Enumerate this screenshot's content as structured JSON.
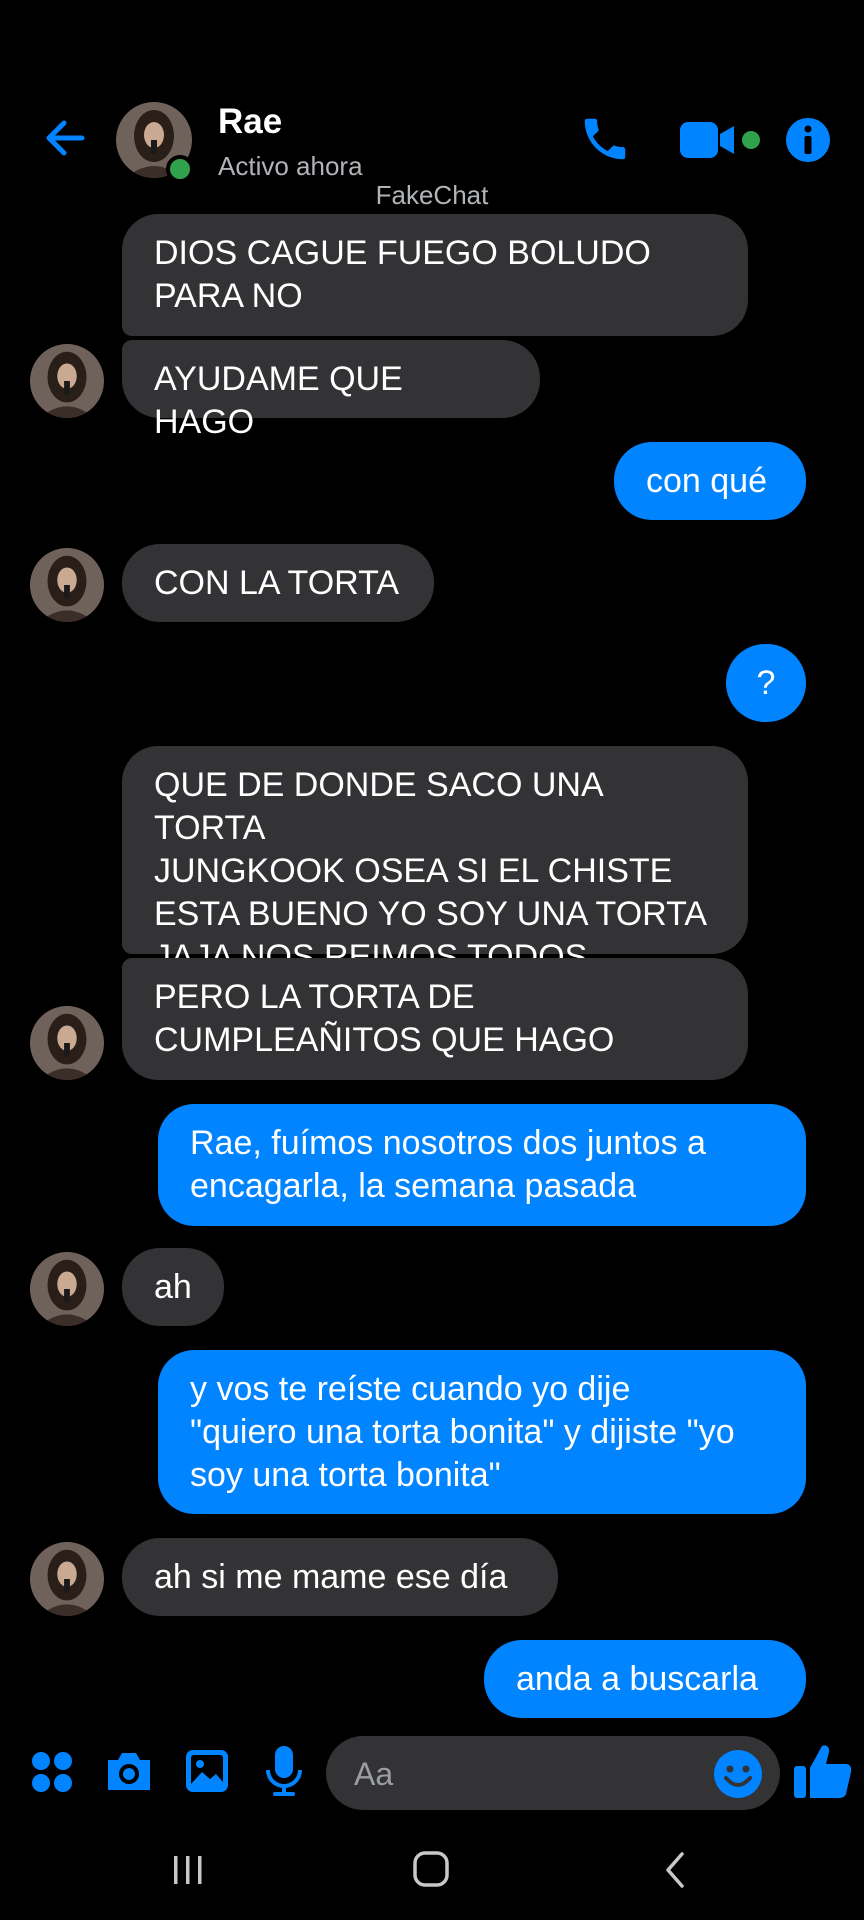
{
  "header": {
    "name": "Rae",
    "status": "Activo ahora",
    "watermark": "FakeChat"
  },
  "colors": {
    "accent": "#0084ff",
    "incoming_bubble": "#333336",
    "online": "#31a24c",
    "background": "#000000"
  },
  "messages": [
    {
      "from": "them",
      "lines": [
        "DIOS CAGUE FUEGO BOLUDO",
        "PARA NO"
      ]
    },
    {
      "from": "them",
      "lines": [
        "AYUDAME QUE HAGO"
      ]
    },
    {
      "from": "me",
      "lines": [
        "con qué"
      ]
    },
    {
      "from": "them",
      "lines": [
        "CON LA TORTA"
      ]
    },
    {
      "from": "me",
      "lines": [
        "?"
      ]
    },
    {
      "from": "them",
      "lines": [
        "QUE DE DONDE SACO UNA TORTA",
        "JUNGKOOK OSEA SI EL CHISTE",
        "ESTA BUENO YO SOY UNA TORTA",
        "JAJA NOS REIMOS TODOS"
      ]
    },
    {
      "from": "them",
      "lines": [
        "PERO LA TORTA DE",
        "CUMPLEAÑITOS QUE HAGO"
      ]
    },
    {
      "from": "me",
      "lines": [
        "Rae, fuímos nosotros dos juntos a",
        "encagarla, la semana pasada"
      ]
    },
    {
      "from": "them",
      "lines": [
        "ah"
      ]
    },
    {
      "from": "me",
      "lines": [
        "y vos te reíste cuando yo dije",
        "\"quiero una torta bonita\" y dijiste \"yo",
        "soy una torta bonita\""
      ]
    },
    {
      "from": "them",
      "lines": [
        "ah si me mame ese día"
      ]
    },
    {
      "from": "me",
      "lines": [
        "anda a buscarla"
      ]
    }
  ],
  "composer": {
    "placeholder": "Aa"
  },
  "icons": {
    "back": "arrow-left-icon",
    "call": "phone-icon",
    "video": "video-camera-icon",
    "info": "info-icon",
    "apps": "apps-grid-icon",
    "camera": "camera-icon",
    "gallery": "gallery-icon",
    "mic": "microphone-icon",
    "emoji": "emoji-icon",
    "like": "thumbs-up-icon"
  }
}
